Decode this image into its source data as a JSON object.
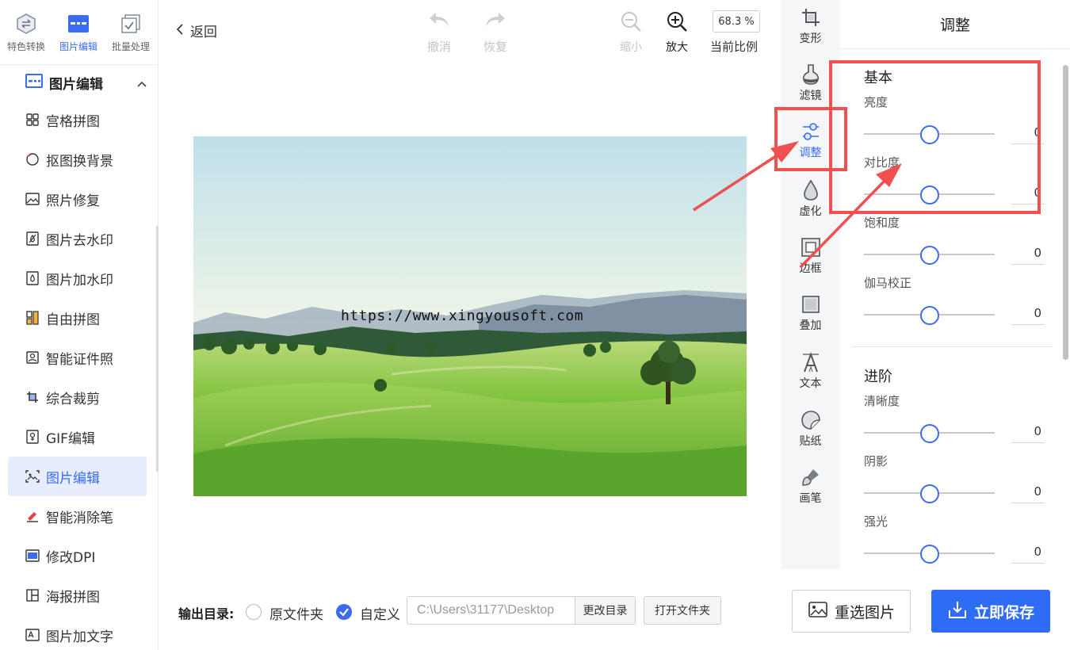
{
  "sidebar": {
    "top_tabs": [
      {
        "label": "特色转换",
        "icon": "convert-icon"
      },
      {
        "label": "图片编辑",
        "icon": "image-edit-icon"
      },
      {
        "label": "批量处理",
        "icon": "batch-icon"
      }
    ],
    "section_label": "图片编辑",
    "items": [
      {
        "label": "宫格拼图",
        "icon": "grid-icon"
      },
      {
        "label": "抠图换背景",
        "icon": "cutout-icon"
      },
      {
        "label": "照片修复",
        "icon": "photo-icon"
      },
      {
        "label": "图片去水印",
        "icon": "remove-watermark-icon"
      },
      {
        "label": "图片加水印",
        "icon": "add-watermark-icon"
      },
      {
        "label": "自由拼图",
        "icon": "collage-icon"
      },
      {
        "label": "智能证件照",
        "icon": "id-photo-icon"
      },
      {
        "label": "综合裁剪",
        "icon": "crop-icon"
      },
      {
        "label": "GIF编辑",
        "icon": "gif-icon"
      },
      {
        "label": "图片编辑",
        "icon": "image-edit-icon"
      },
      {
        "label": "智能消除笔",
        "icon": "eraser-icon"
      },
      {
        "label": "修改DPI",
        "icon": "dpi-icon"
      },
      {
        "label": "海报拼图",
        "icon": "poster-icon"
      },
      {
        "label": "图片加文字",
        "icon": "add-text-icon"
      }
    ],
    "active_index": 9
  },
  "toolbar": {
    "back_label": "返回",
    "undo_label": "撤消",
    "redo_label": "恢复",
    "zoom_out_label": "缩小",
    "zoom_in_label": "放大",
    "zoom_value": "68.3 %",
    "zoom_caption": "当前比例"
  },
  "canvas": {
    "watermark_text": "https://www.xingyousoft.com"
  },
  "tools": [
    {
      "label": "变形",
      "icon": "transform-icon"
    },
    {
      "label": "滤镜",
      "icon": "filter-icon"
    },
    {
      "label": "调整",
      "icon": "adjust-icon"
    },
    {
      "label": "虚化",
      "icon": "blur-icon"
    },
    {
      "label": "边框",
      "icon": "border-icon"
    },
    {
      "label": "叠加",
      "icon": "overlay-icon"
    },
    {
      "label": "文本",
      "icon": "text-icon"
    },
    {
      "label": "贴纸",
      "icon": "sticker-icon"
    },
    {
      "label": "画笔",
      "icon": "brush-icon"
    }
  ],
  "active_tool": 2,
  "panel": {
    "title": "调整",
    "basic_title": "基本",
    "basic": [
      {
        "label": "亮度",
        "value": "0"
      },
      {
        "label": "对比度",
        "value": "0"
      },
      {
        "label": "饱和度",
        "value": "0"
      },
      {
        "label": "伽马校正",
        "value": "0"
      }
    ],
    "advanced_title": "进阶",
    "advanced": [
      {
        "label": "清晰度",
        "value": "0"
      },
      {
        "label": "阴影",
        "value": "0"
      },
      {
        "label": "强光",
        "value": "0"
      }
    ],
    "slider_position": 0.5
  },
  "bottom": {
    "output_label": "输出目录:",
    "option_original": "原文件夹",
    "option_custom": "自定义",
    "path_value": "C:\\Users\\31177\\Desktop",
    "change_dir_label": "更改目录",
    "open_folder_label": "打开文件夹",
    "reselect_label": "重选图片",
    "save_label": "立即保存"
  },
  "colors": {
    "accent": "#3a6bf2",
    "save_button": "#2e6cf6",
    "annotation": "#f0504f"
  }
}
